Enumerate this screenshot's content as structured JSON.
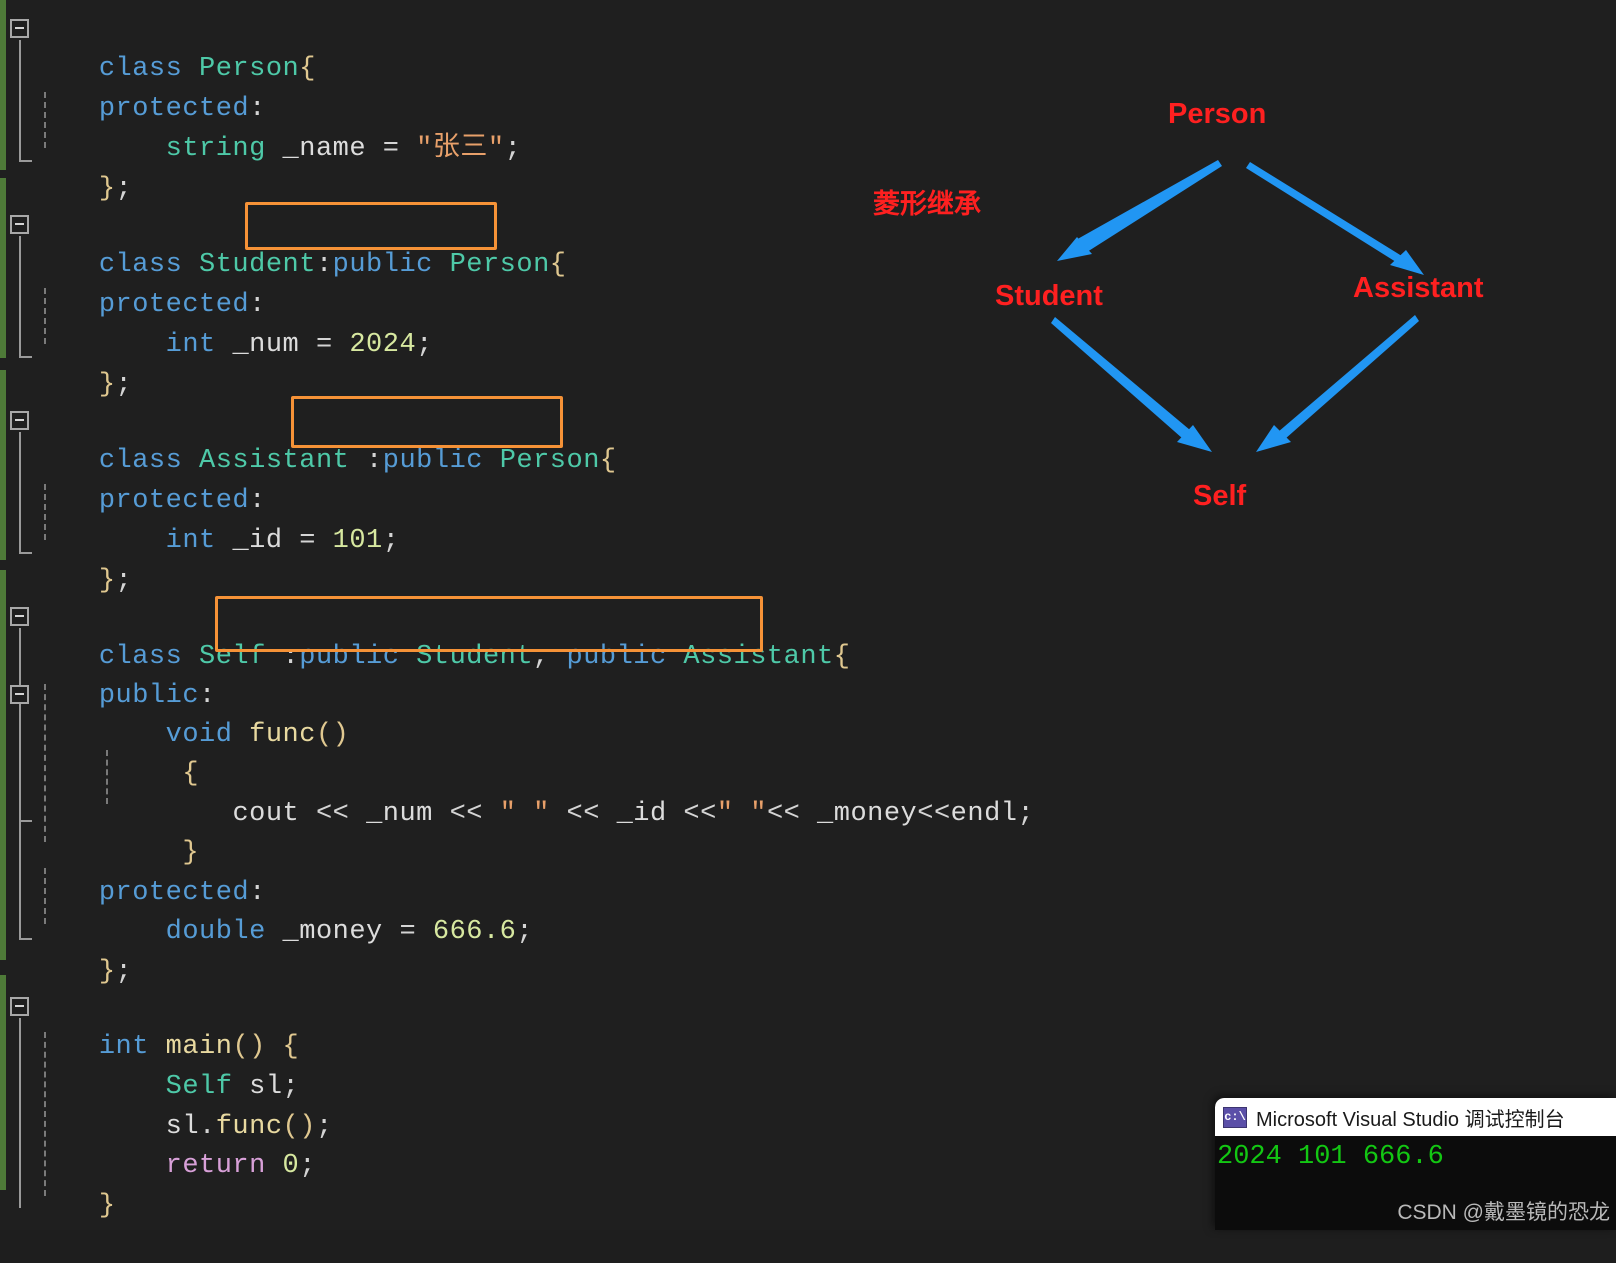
{
  "editor": {
    "background_color": "#1f1f1f",
    "change_bar_color": "#4e7a38",
    "highlight_color": "#f59237",
    "code_lines": [
      {
        "id": "l1",
        "text": "class Person{"
      },
      {
        "id": "l2",
        "text": "protected:"
      },
      {
        "id": "l3",
        "text": "    string _name = \"张三\";"
      },
      {
        "id": "l4",
        "text": "};"
      },
      {
        "id": "l5",
        "text": "class Student:public Person{"
      },
      {
        "id": "l6",
        "text": "protected:"
      },
      {
        "id": "l7",
        "text": "    int _num = 2024;"
      },
      {
        "id": "l8",
        "text": "};"
      },
      {
        "id": "l9",
        "text": "class Assistant :public Person{"
      },
      {
        "id": "l10",
        "text": "protected:"
      },
      {
        "id": "l11",
        "text": "    int _id = 101;"
      },
      {
        "id": "l12",
        "text": "};"
      },
      {
        "id": "l13",
        "text": "class Self :public Student, public Assistant{"
      },
      {
        "id": "l14",
        "text": "public:"
      },
      {
        "id": "l15",
        "text": "    void func()"
      },
      {
        "id": "l16",
        "text": "    {"
      },
      {
        "id": "l17",
        "text": "        cout << _num << \" \" << _id <<\" \"<< _money<<endl;"
      },
      {
        "id": "l18",
        "text": "    }"
      },
      {
        "id": "l19",
        "text": "protected:"
      },
      {
        "id": "l20",
        "text": "    double _money = 666.6;"
      },
      {
        "id": "l21",
        "text": "};"
      },
      {
        "id": "l22",
        "text": "int main() {"
      },
      {
        "id": "l23",
        "text": "    Self sl;"
      },
      {
        "id": "l24",
        "text": "    sl.func();"
      },
      {
        "id": "l25",
        "text": "    return 0;"
      },
      {
        "id": "l26",
        "text": "}"
      }
    ],
    "tokens": {
      "kw_class": "class",
      "kw_public": "public",
      "kw_protected": "protected",
      "kw_int": "int",
      "kw_void": "void",
      "kw_double": "double",
      "kw_string": "string",
      "kw_return": "return",
      "type_person": "Person",
      "type_student": "Student",
      "type_assistant": "Assistant",
      "type_self": "Self",
      "ident_name": "_name",
      "ident_num": "_num",
      "ident_id": "_id",
      "ident_money": "_money",
      "ident_sl": "sl",
      "ident_cout": "cout",
      "ident_endl": "endl",
      "func_func": "func",
      "func_main": "main",
      "val_zhangsan": "\"张三\"",
      "val_2024": "2024",
      "val_101": "101",
      "val_666": "666.6",
      "val_0": "0",
      "val_space_str": "\" \""
    },
    "highlight_boxes": [
      {
        "name": "student-inheritance-highlight",
        "label": ":public Person{"
      },
      {
        "name": "assistant-inheritance-highlight",
        "label": ":public Person{"
      },
      {
        "name": "self-inheritance-highlight",
        "label": ":public Student, public Assistant{"
      }
    ]
  },
  "diagram": {
    "note": "菱形继承",
    "note_color": "#fe2020",
    "arrow_color": "#2196f3",
    "nodes": [
      {
        "id": "person",
        "label": "Person"
      },
      {
        "id": "student",
        "label": "Student"
      },
      {
        "id": "assistant",
        "label": "Assistant"
      },
      {
        "id": "self",
        "label": "Self"
      }
    ],
    "edges": [
      {
        "from": "Person",
        "to": "Student"
      },
      {
        "from": "Person",
        "to": "Assistant"
      },
      {
        "from": "Student",
        "to": "Self"
      },
      {
        "from": "Assistant",
        "to": "Self"
      }
    ]
  },
  "console": {
    "title": "Microsoft Visual Studio 调试控制台",
    "icon": "console-app-icon",
    "icon_text": "c:\\",
    "output": "2024 101 666.6",
    "output_color": "#13c713",
    "watermark": "CSDN @戴墨镜的恐龙"
  }
}
